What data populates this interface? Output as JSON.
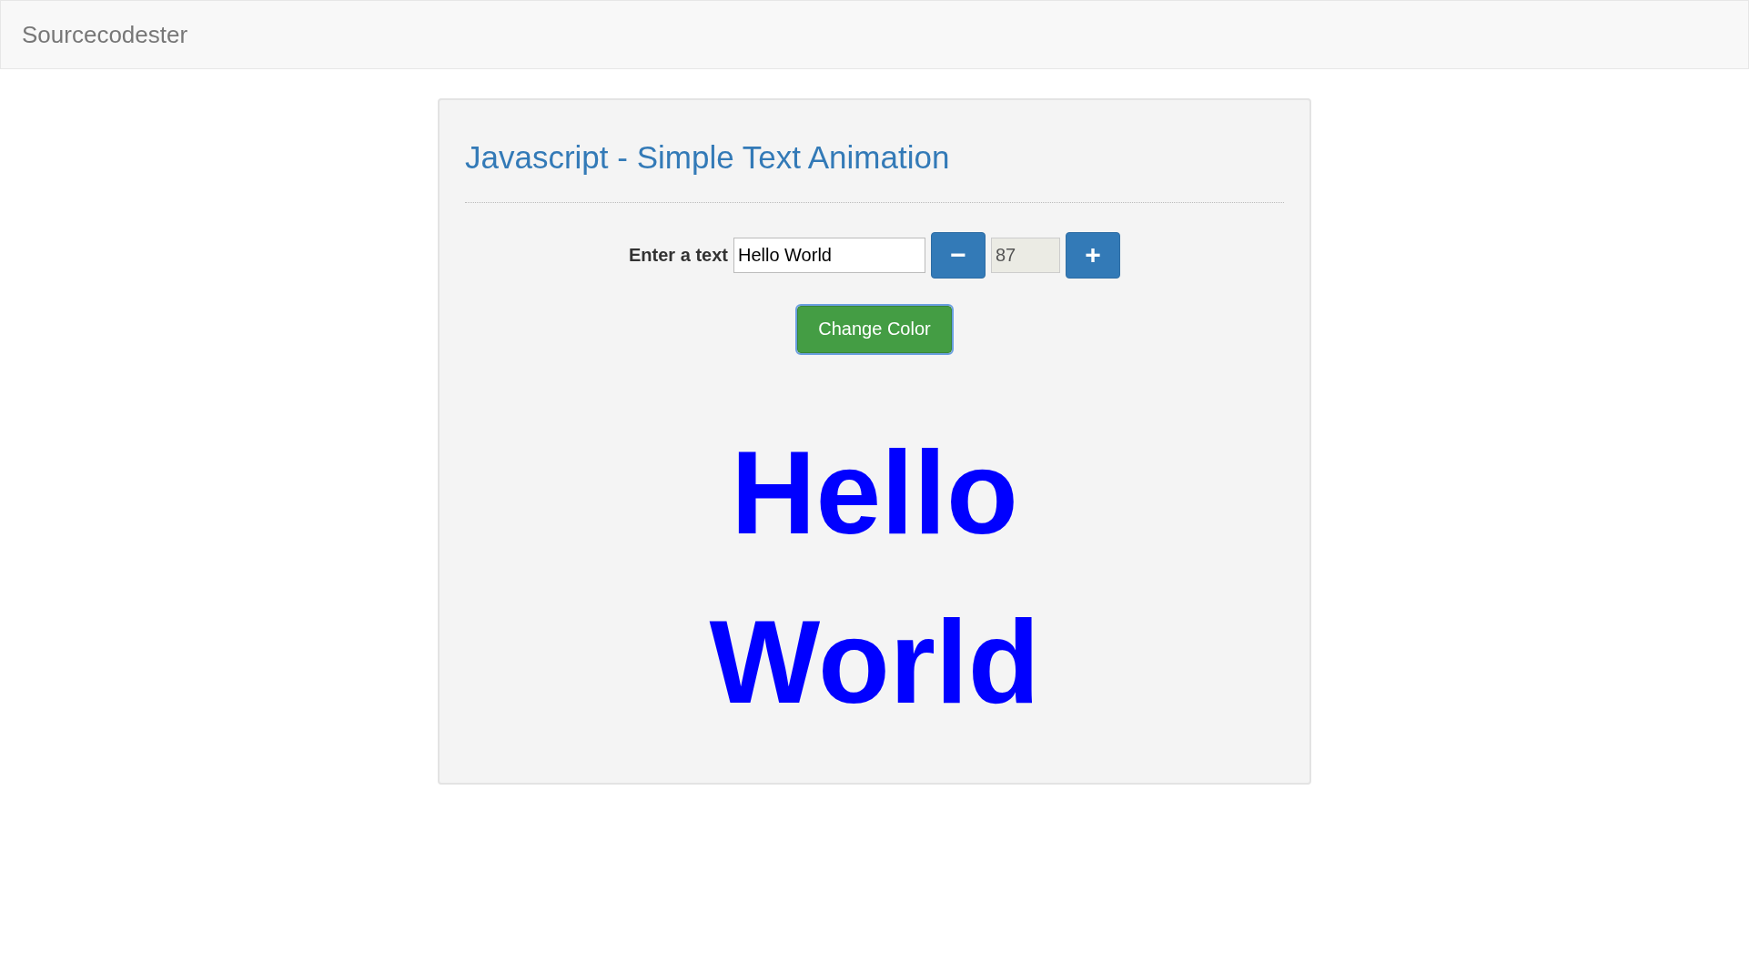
{
  "navbar": {
    "brand": "Sourcecodester"
  },
  "card": {
    "title": "Javascript - Simple Text Animation",
    "text_label": "Enter a text",
    "text_input": {
      "value": "Hello World"
    },
    "decrease_button": {
      "label": "−"
    },
    "size_field": {
      "value": "87"
    },
    "increase_button": {
      "label": "+"
    },
    "color_button": {
      "label": "Change Color",
      "focused": true
    },
    "preview_lines": [
      "Hello",
      "World"
    ]
  }
}
